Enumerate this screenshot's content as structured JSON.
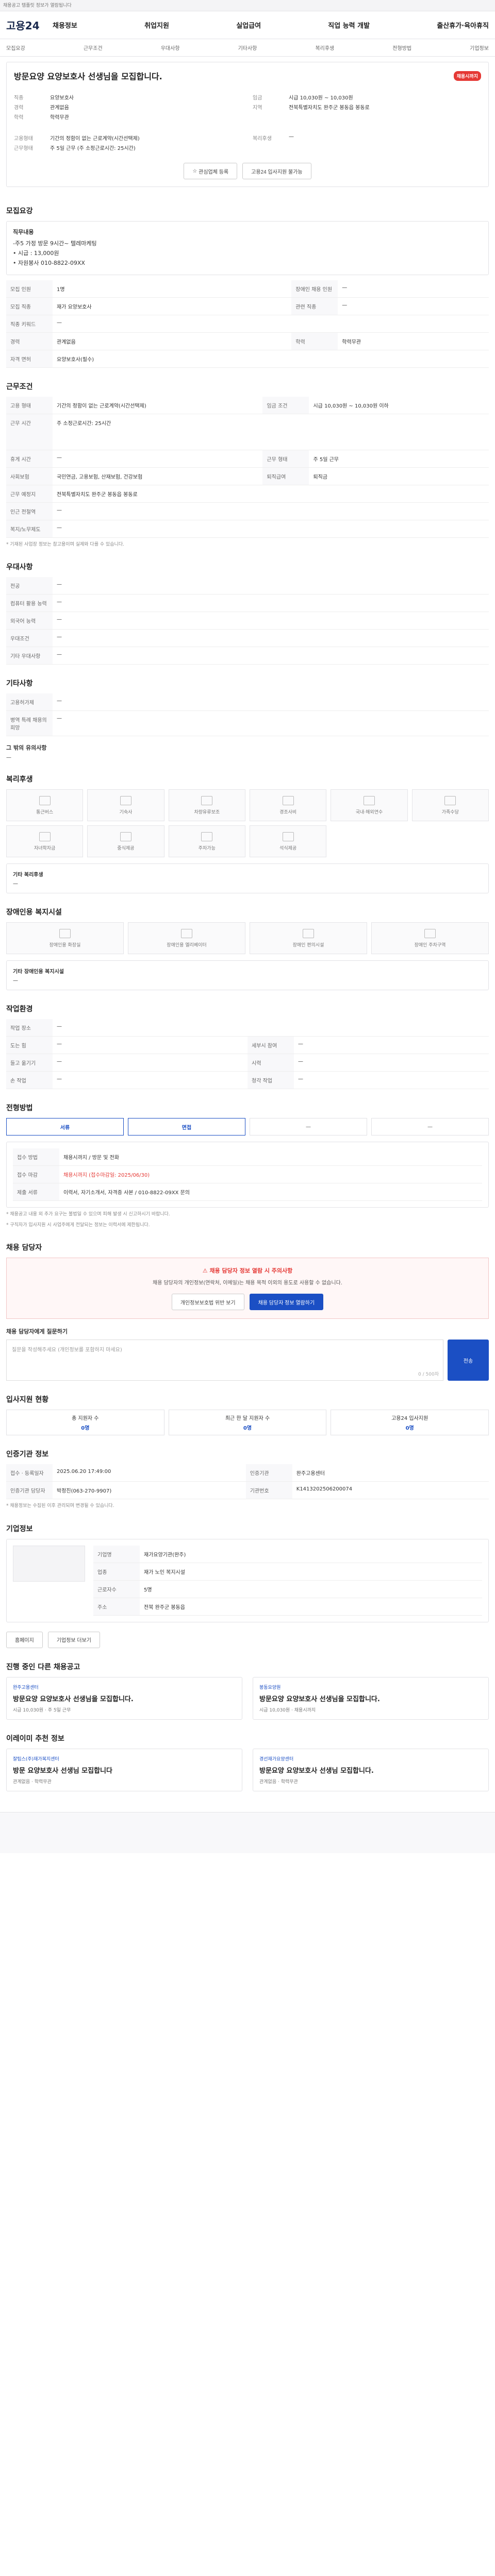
{
  "topbar": {
    "notice": "채용공고 템플릿 정보가 열람됩니다"
  },
  "gnb": {
    "logo": "고용24",
    "menus": [
      "채용정보",
      "취업지원",
      "실업급여",
      "직업 능력 개발",
      "출산휴가·육아휴직"
    ]
  },
  "sub": {
    "items": [
      "모집요강",
      "근무조건",
      "우대사항",
      "기타사항",
      "복리후생",
      "전형방법",
      "기업정보"
    ]
  },
  "hero": {
    "title": "방문요양 요양보호사 선생님을 모집합니다.",
    "badge": "채용시까지",
    "left": [
      {
        "k": "직종",
        "v": "요양보호사"
      },
      {
        "k": "경력",
        "v": "관계없음"
      },
      {
        "k": "학력",
        "v": "학력무관"
      }
    ],
    "right": [
      {
        "k": "임금",
        "v": "시급 10,030원 ~ 10,030원"
      },
      {
        "k": "지역",
        "v": "전북특별자치도 완주군 봉동읍 봉동로"
      }
    ],
    "left2": [
      {
        "k": "고용형태",
        "v": "기간의 정함이 없는 근로계약(시간선택제)"
      },
      {
        "k": "근무형태",
        "v": "주 5일 근무 (주 소정근로시간: 25시간)"
      }
    ],
    "right2": [
      {
        "k": "복리후생",
        "v": "—"
      }
    ],
    "btn_apply": "관심업체 등록",
    "btn_share": "고용24 입사지원 불가능"
  },
  "recruit": {
    "title": "모집요강",
    "lines": [
      "직무내용",
      "-주5 가정 방문 9시간~ 텔레마케팅",
      "• 시급 : 13,000원",
      "• 자원봉사 010-8822-09XX"
    ],
    "rows": [
      [
        "모집 인원",
        "1명",
        "장애인 채용 인원",
        "—"
      ],
      [
        "모집 직종",
        "재가 요양보호사",
        "관련 직종",
        "—"
      ],
      [
        "직종 키워드",
        "—",
        "",
        ""
      ],
      [
        "경력",
        "관계없음",
        "학력",
        "학력무관"
      ],
      [
        "자격 면허",
        "요양보호사(필수)",
        "",
        ""
      ]
    ]
  },
  "work": {
    "title": "근무조건",
    "rows": [
      [
        "고용 형태",
        "기간의 정함이 없는 근로계약(시간선택제)",
        "임금 조건",
        "시급 10,030원 ~ 10,030원 이하"
      ],
      [
        "근무 시간",
        "주 소정근로시간: 25시간",
        "",
        ""
      ],
      [
        "휴게 시간",
        "—",
        "근무 형태",
        "주 5일 근무"
      ],
      [
        "사회보험",
        "국민연금, 고용보험, 산재보험, 건강보험",
        "퇴직급여",
        "퇴직금"
      ],
      [
        "근무 예정지",
        "전북특별자치도 완주군 봉동읍 봉동로",
        "",
        ""
      ],
      [
        "인근 전철역",
        "—",
        "",
        ""
      ],
      [
        "복지/노무제도",
        "—",
        "",
        ""
      ]
    ],
    "note": "* 기재된 사업장 정보는 참고용이며 실제와 다를 수 있습니다."
  },
  "pref": {
    "title": "우대사항",
    "rows": [
      [
        "전공",
        "—"
      ],
      [
        "컴퓨터 활용 능력",
        "—"
      ],
      [
        "외국어 능력",
        "—"
      ],
      [
        "우대조건",
        "—"
      ],
      [
        "기타 우대사항",
        "—"
      ]
    ]
  },
  "etc": {
    "title": "기타사항",
    "rows": [
      [
        "고용허가제",
        "—"
      ],
      [
        "병역 특례 채용의 희망",
        "—"
      ]
    ],
    "sub": "그 밖의 유의사항",
    "subv": "—"
  },
  "welfare": {
    "title": "복리후생",
    "items": [
      "통근버스",
      "기숙사",
      "차량유류보조",
      "경조사비",
      "국내·해외연수",
      "가족수당",
      "자녀학자금",
      "중식제공",
      "주차가능",
      "석식제공",
      "",
      ""
    ],
    "sub": "기타 복리후생",
    "subv": "—"
  },
  "disabled": {
    "title": "장애인용 복지시설",
    "items": [
      "장애인용 화장실",
      "장애인용 엘리베이터",
      "장애인 편의시설",
      "장애인 주차구역"
    ],
    "sub": "기타 장애인용 복지시설",
    "subv": "—"
  },
  "env": {
    "title": "작업환경",
    "rows": [
      [
        "작업 장소",
        "—",
        "",
        ""
      ],
      [
        "도는 힘",
        "—",
        "세부시 참여",
        "—"
      ],
      [
        "들고 옮기기",
        "—",
        "시력",
        "—"
      ],
      [
        "손 작업",
        "—",
        "청각 작업",
        "—"
      ]
    ]
  },
  "process": {
    "title": "전형방법",
    "steps": [
      "서류",
      "면접",
      "—",
      "—"
    ],
    "rows": [
      [
        "접수 방법",
        "채용시까지 / 방문 및 전화"
      ],
      [
        "접수 마감",
        "채용시까지 (접수마감일: 2025/06/30)"
      ],
      [
        "제출 서류",
        "이력서, 자기소개서, 자격증 사본 / 010-8822-09XX 문의"
      ]
    ],
    "notes": [
      "* 채용공고 내용 외 추가 요구는 불법일 수 있으며 피해 발생 시 신고하시기 바랍니다.",
      "* 구직자가 입사지원 시 사업주에게 전달되는 정보는 이력서에 제한됩니다."
    ]
  },
  "contact": {
    "title": "채용 담당자",
    "alert_h": "채용 담당자 정보 열람 시 주의사항",
    "alert_p": "채용 담당자의 개인정보(연락처, 이메일)는 채용 목적 이외의 용도로 사용할 수 없습니다.",
    "btn1": "개인정보보호법 위반 보기",
    "btn2": "채용 담당자 정보 열람하기",
    "q": "채용 담당자에게 질문하기",
    "placeholder": "질문을 작성해주세요 (개인정보를 포함하지 마세요)",
    "count": "0 / 500자",
    "submit": "전송"
  },
  "stats": {
    "title": "입사지원 현황",
    "cells": [
      [
        "총 지원자 수",
        "0명"
      ],
      [
        "최근 한 달 지원자 수",
        "0명"
      ],
      [
        "고용24 입사지원",
        "0명"
      ]
    ]
  },
  "agency": {
    "title": "인증기관 정보",
    "rows": [
      [
        "접수 · 등록일자",
        "2025.06.20 17:49:00",
        "인증기관",
        "완주고용센터"
      ],
      [
        "인증기관 담당자",
        "박정진(063-270-9907)",
        "기관번호",
        "K1413202506200074"
      ]
    ],
    "note": "* 채용정보는 수집된 이후 관리되며 변경될 수 있습니다."
  },
  "company": {
    "title": "기업정보",
    "rows": [
      [
        "기업명",
        "재가요양기관(완주)"
      ],
      [
        "업종",
        "재가 노인 복지시설"
      ],
      [
        "근로자수",
        "5명"
      ],
      [
        "주소",
        "전북 완주군 봉동읍"
      ]
    ],
    "btn1": "홈페이지",
    "btn2": "기업정보 더보기"
  },
  "similar": {
    "title": "진행 중인 다른 채용공고",
    "cards": [
      {
        "tag": "완주고용센터",
        "title": "방문요양 요양보호사 선생님을 모집합니다.",
        "meta": "시급 10,030원 · 주 5일 근무"
      },
      {
        "tag": "봉동요양원",
        "title": "방문요양 요양보호사 선생님을 모집합니다.",
        "meta": "시급 10,030원 · 채용시까지"
      }
    ]
  },
  "recommend": {
    "title": "이레이미 추천 정보",
    "cards": [
      {
        "tag": "잘팁스(주)재가복지센터",
        "title": "방문 요양보호사 선생님 모집합니다",
        "meta": "관계없음 · 학력무관"
      },
      {
        "tag": "경선재가요양센터",
        "title": "방문요양 요양보호사 선생님 모집합니다.",
        "meta": "관계없음 · 학력무관"
      }
    ]
  }
}
